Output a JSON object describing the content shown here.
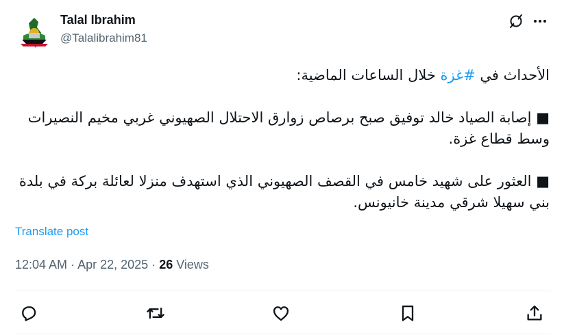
{
  "author": {
    "name": "Talal Ibrahim",
    "handle": "@Talalibrahim81"
  },
  "tweet": {
    "line1_prefix": "الأحداث في ",
    "hashtag": "#غزة",
    "line1_suffix": " خلال الساعات الماضية:",
    "item1": "■ إصابة الصياد خالد توفيق صبح برصاص زوارق الاحتلال الصهيوني غربي مخيم النصيرات وسط قطاع غزة.",
    "item2": "■ العثور على شهيد خامس في القصف الصهيوني الذي استهدف منزلا لعائلة بركة في بلدة بني سهيلا شرقي مدينة خانيونس."
  },
  "translate_label": "Translate post",
  "meta": {
    "time": "12:04 AM",
    "date": "Apr 22, 2025",
    "views_count": "26",
    "views_label": "Views"
  },
  "icons": {
    "grok": "grok-icon",
    "more": "more-icon",
    "reply": "reply-icon",
    "repost": "repost-icon",
    "like": "like-icon",
    "bookmark": "bookmark-icon",
    "share": "share-icon"
  },
  "colors": {
    "accent": "#1d9bf0",
    "text": "#0f1419",
    "secondary": "#536471"
  }
}
